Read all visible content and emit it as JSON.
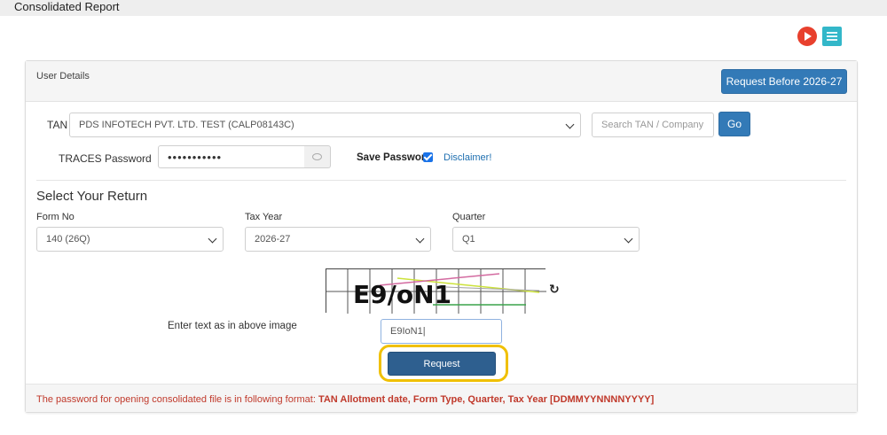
{
  "header": {
    "title": "Consolidated Report"
  },
  "toolbar": {
    "play_icon": "play-icon",
    "doc_icon": "document-icon"
  },
  "panel": {
    "title": "User Details",
    "request_before_label": "Request Before 2026-27"
  },
  "tan": {
    "label": "TAN",
    "selected": "PDS INFOTECH PVT. LTD. TEST (CALP08143C)",
    "search_placeholder": "Search TAN / Company",
    "go_label": "Go"
  },
  "password": {
    "label": "TRACES Password",
    "value": "•••••••••••",
    "save_label": "Save Password",
    "save_checked": true,
    "disclaimer_label": "Disclaimer!"
  },
  "return": {
    "section_title": "Select Your Return",
    "form_label": "Form No",
    "form_value": "140 (26Q)",
    "tax_year_label": "Tax Year",
    "tax_year_value": "2026-27",
    "quarter_label": "Quarter",
    "quarter_value": "Q1"
  },
  "captcha": {
    "image_text": "E9/oN1",
    "prompt": "Enter text as in above image",
    "input_value": "E9IoN1|",
    "refresh_icon": "refresh-icon"
  },
  "request_label": "Request",
  "note": {
    "prefix": "The password for opening consolidated file is in following format: ",
    "format": "TAN Allotment date, Form Type, Quarter, Tax Year [DDMMYYNNNNYYYY]"
  }
}
